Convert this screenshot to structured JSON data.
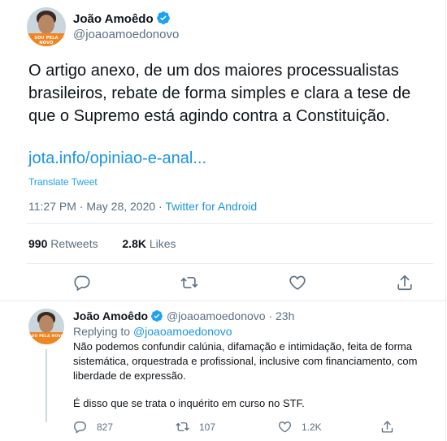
{
  "tweet": {
    "author_name": "João Amoêdo",
    "author_handle": "@joaoamoedonovo",
    "avatar_badge": "SOU PELA NOVO",
    "text": "O artigo anexo, de um dos maiores processualistas brasileiros, rebate de forma simples e clara a tese de que o Supremo está agindo contra a Constituição.",
    "link": "jota.info/opiniao-e-anal...",
    "translate_label": "Translate Tweet",
    "time": "11:27 PM · May 28, 2020 · ",
    "source": "Twitter for Android",
    "retweets_count": "990",
    "retweets_label": "Retweets",
    "likes_count": "2.8K",
    "likes_label": "Likes"
  },
  "reply": {
    "author_name": "João Amoêdo",
    "author_handle": "@joaoamoedonovo",
    "age": " · 23h",
    "replying_prefix": "Replying to ",
    "replying_to": "@joaoamoedonovo",
    "text": "Não podemos confundir calúnia, difamação e intimidação, feita de forma sistemática, orquestrada e profissional, inclusive com financiamento, com liberdade de expressão.",
    "text2": "É disso que se trata o inquérito em curso no STF.",
    "replies_count": "827",
    "retweets_count": "107",
    "likes_count": "1.2K"
  },
  "icons": [
    "verified-badge",
    "reply-icon",
    "retweet-icon",
    "like-icon",
    "share-icon"
  ],
  "colors": {
    "link": "#1b95e0",
    "verified": "#1da1f2",
    "muted": "#5b7083",
    "divider": "#e6ecf0"
  }
}
